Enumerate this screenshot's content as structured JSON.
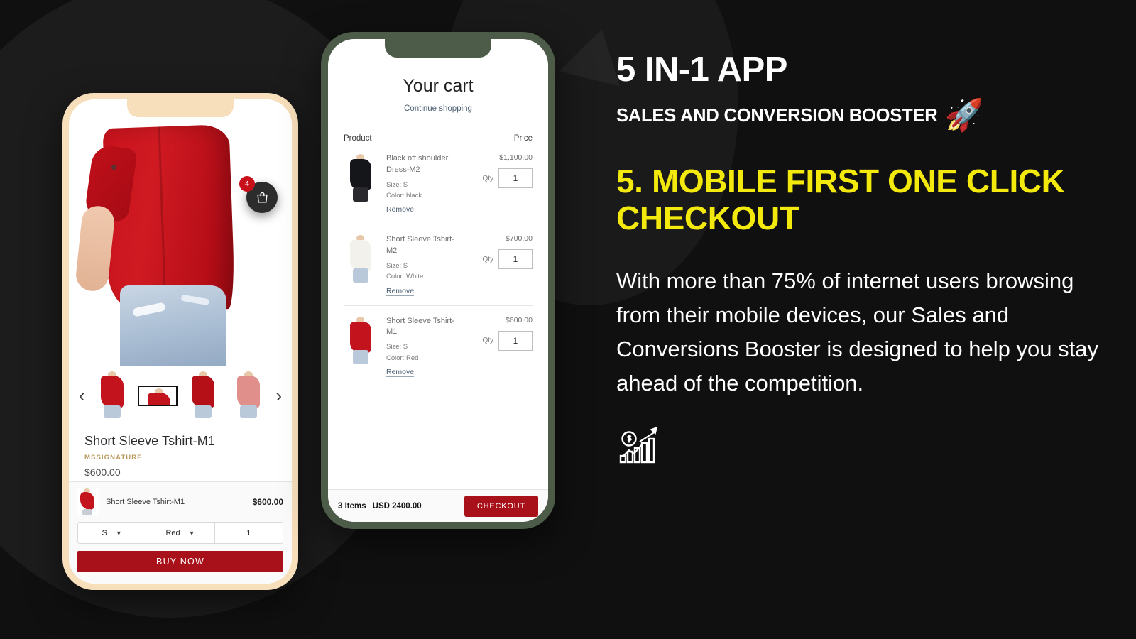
{
  "background": {
    "color": "#101010"
  },
  "phone_product": {
    "frame_color": "#F7DFBC",
    "cart_fab": {
      "icon": "shopping-bag-icon",
      "badge_count": "4"
    },
    "carousel": {
      "prev_icon": "chevron-left-icon",
      "next_icon": "chevron-right-icon",
      "thumbnails": [
        {
          "label": "red-tshirt-front",
          "color": "#C3131D",
          "selected": false
        },
        {
          "label": "red-tshirt-side",
          "color": "#C3131D",
          "selected": true
        },
        {
          "label": "red-tshirt-back",
          "color": "#B50F18",
          "selected": false
        },
        {
          "label": "pink-tshirt",
          "color": "#E08F8B",
          "selected": false
        }
      ]
    },
    "product": {
      "title": "Short Sleeve Tshirt-M1",
      "brand": "MSSIGNATURE",
      "price": "$600.00"
    },
    "buy_bar": {
      "item_name": "Short Sleeve Tshirt-M1",
      "item_price": "$600.00",
      "size_value": "S",
      "color_value": "Red",
      "qty_value": "1",
      "buy_label": "BUY NOW",
      "chevron_icon": "chevron-down-icon"
    }
  },
  "phone_cart": {
    "frame_color": "#4D5C48",
    "title": "Your cart",
    "continue_link": "Continue shopping",
    "col_product": "Product",
    "col_price": "Price",
    "qty_label": "Qty",
    "remove_label": "Remove",
    "items": [
      {
        "name": "Black off shoulder Dress-M2",
        "price": "$1,100.00",
        "size": "Size: S",
        "color": "Color: black",
        "qty": "1",
        "swatch": "#15161A",
        "legs": "#2A2A2E"
      },
      {
        "name": "Short Sleeve Tshirt-M2",
        "price": "$700.00",
        "size": "Size: S",
        "color": "Color: White",
        "qty": "1",
        "swatch": "#F3F1EC",
        "legs": "#B9C9DA"
      },
      {
        "name": "Short Sleeve Tshirt-M1",
        "price": "$600.00",
        "size": "Size: S",
        "color": "Color: Red",
        "qty": "1",
        "swatch": "#C3131D",
        "legs": "#B9C9DA"
      }
    ],
    "footer": {
      "items_count": "3 Items",
      "total": "USD 2400.00",
      "checkout_label": "CHECKOUT"
    }
  },
  "right_panel": {
    "kicker": "5 IN-1 APP",
    "sub_kicker": "SALES AND CONVERSION BOOSTER",
    "rocket_icon": "🚀",
    "headline": "5. MOBILE FIRST ONE CLICK CHECKOUT",
    "paragraph": "With more than 75% of internet users browsing from their mobile devices, our Sales and Conversions Booster is designed to help you stay ahead of the competition.",
    "growth_icon": "growth-chart-dollar-icon",
    "accent_yellow": "#F3E90D",
    "accent_red": "#A8111A"
  }
}
